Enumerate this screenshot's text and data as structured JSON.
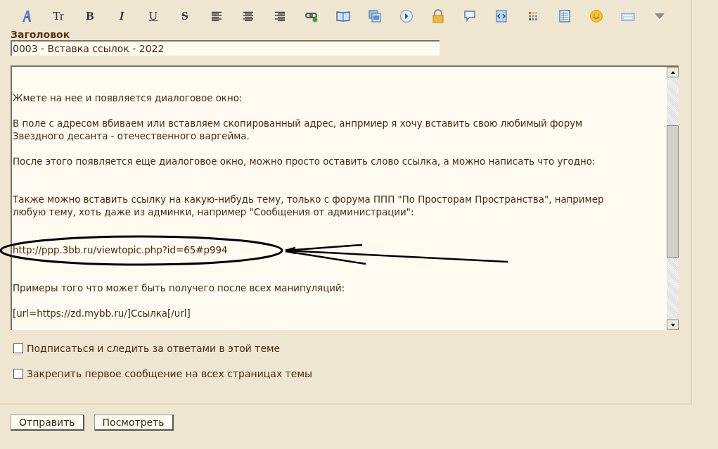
{
  "toolbar": [
    {
      "kind": "font-color"
    },
    {
      "kind": "glyph",
      "glyph": "Tr"
    },
    {
      "kind": "bold",
      "glyph": "B"
    },
    {
      "kind": "italic",
      "glyph": "I"
    },
    {
      "kind": "underline",
      "glyph": "U"
    },
    {
      "kind": "strike",
      "glyph": "S"
    },
    {
      "kind": "align-left"
    },
    {
      "kind": "align-center"
    },
    {
      "kind": "align-right"
    },
    {
      "kind": "link"
    },
    {
      "kind": "book"
    },
    {
      "kind": "images"
    },
    {
      "kind": "play"
    },
    {
      "kind": "lock"
    },
    {
      "kind": "speech"
    },
    {
      "kind": "script"
    },
    {
      "kind": "palette"
    },
    {
      "kind": "table"
    },
    {
      "kind": "smiley"
    },
    {
      "kind": "keyboard"
    },
    {
      "kind": "more"
    }
  ],
  "title_field": {
    "label": "Заголовок",
    "value": "0003 - Вставка ссылок - 2022"
  },
  "message": {
    "value": "Жмете на нее и появляется диалоговое окно:\n\nВ поле с адресом вбиваем или вставляем скопированный адрес, анпрмиер я хочу вставить свою любимый форум\nЗвездного десанта - отечественного варгейма.\n\nПосле этого появляется еще диалоговое окно, можно просто оставить слово ссылка, а можно написать что угодно:\n\n\nТакже можно вставить ссылку на какую-нибудь тему, только с форума ППП \"По Просторам Пространства\", например\nлюбую тему, хоть даже из админки, например \"Сообщения от администрации\":\n\n\nhttp://ppp.3bb.ru/viewtopic.php?id=65#p994\n\n\nПримеры того что может быть получего после всех манипуляций:\n\n[url=https://zd.mybb.ru/]Ссылка[/url]"
  },
  "options": [
    {
      "label": "Подписаться и следить за ответами в этой теме",
      "checked": false
    },
    {
      "label": "Закрепить первое сообщение на всех страницах темы",
      "checked": false
    }
  ],
  "buttons": [
    "Отправить",
    "Посмотреть"
  ]
}
